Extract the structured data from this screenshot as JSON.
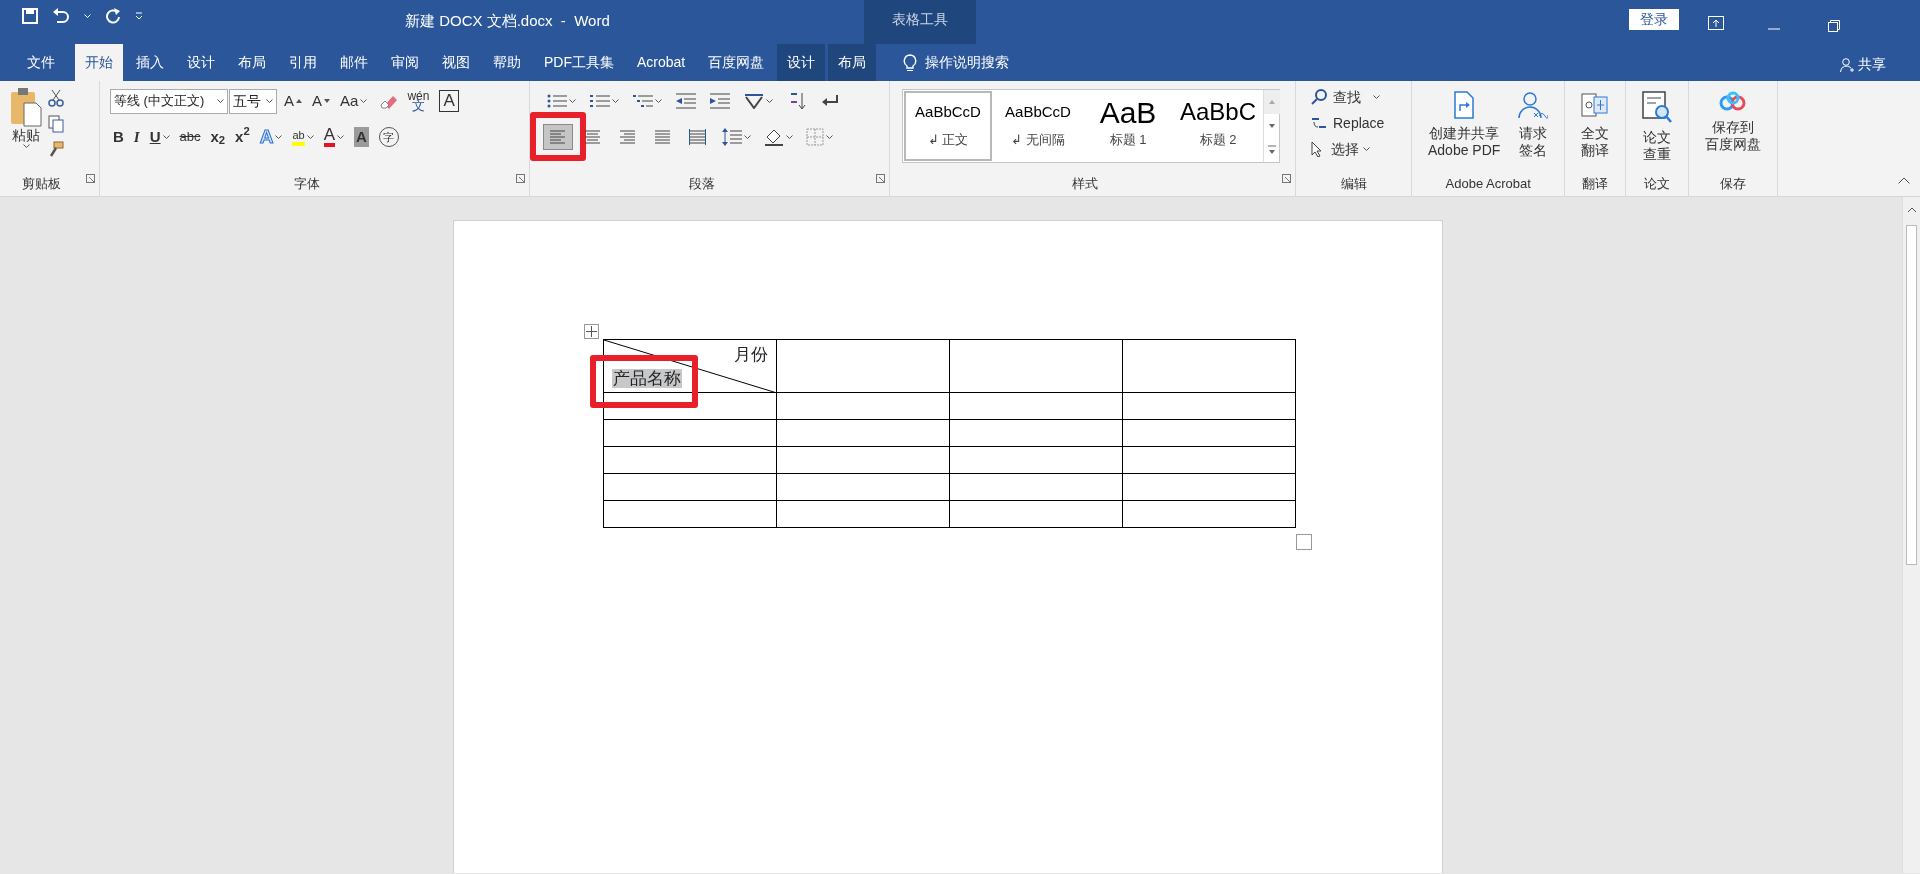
{
  "title_bar": {
    "title": "新建 DOCX 文档.docx  -  Word",
    "context_group": "表格工具",
    "login": "登录"
  },
  "tabs": [
    {
      "label": "文件",
      "kind": "file",
      "selected": false
    },
    {
      "label": "开始",
      "kind": "main",
      "selected": true
    },
    {
      "label": "插入",
      "kind": "main",
      "selected": false
    },
    {
      "label": "设计",
      "kind": "main",
      "selected": false
    },
    {
      "label": "布局",
      "kind": "main",
      "selected": false
    },
    {
      "label": "引用",
      "kind": "main",
      "selected": false
    },
    {
      "label": "邮件",
      "kind": "main",
      "selected": false
    },
    {
      "label": "审阅",
      "kind": "main",
      "selected": false
    },
    {
      "label": "视图",
      "kind": "main",
      "selected": false
    },
    {
      "label": "帮助",
      "kind": "main",
      "selected": false
    },
    {
      "label": "PDF工具集",
      "kind": "main",
      "selected": false
    },
    {
      "label": "Acrobat",
      "kind": "main",
      "selected": false
    },
    {
      "label": "百度网盘",
      "kind": "main",
      "selected": false
    },
    {
      "label": "设计",
      "kind": "context",
      "selected": false
    },
    {
      "label": "布局",
      "kind": "context",
      "selected": false
    }
  ],
  "tell_me": "操作说明搜索",
  "share": "共享",
  "clipboard": {
    "paste": "粘贴",
    "label": "剪贴板"
  },
  "font": {
    "label": "字体",
    "font_name": "等线 (中文正文)",
    "font_size": "五号",
    "row1": [
      {
        "kind": "grow",
        "text": "A"
      },
      {
        "kind": "shrink",
        "text": "A"
      },
      {
        "kind": "case",
        "text": "Aa"
      },
      {
        "kind": "clear"
      },
      {
        "kind": "phonetic",
        "ruby": "wén",
        "text": "文"
      },
      {
        "kind": "boxed",
        "text": "A"
      }
    ],
    "row2": [
      {
        "kind": "bold",
        "text": "B"
      },
      {
        "kind": "italic",
        "text": "I"
      },
      {
        "kind": "underline",
        "text": "U"
      },
      {
        "kind": "strike",
        "text": "abc"
      },
      {
        "kind": "sub",
        "text": "x$_{2}$"
      },
      {
        "kind": "sup",
        "text": "x$^{2}$"
      },
      {
        "kind": "effect",
        "text": "A"
      },
      {
        "kind": "highlight",
        "text": "ab"
      },
      {
        "kind": "color",
        "text": "A"
      },
      {
        "kind": "shade",
        "text": "A"
      },
      {
        "kind": "enclose",
        "text": "字"
      }
    ]
  },
  "paragraph": {
    "label": "段落",
    "row1": [
      {
        "kind": "bullets"
      },
      {
        "kind": "numbering"
      },
      {
        "kind": "multilevel"
      },
      {
        "kind": "outdent"
      },
      {
        "kind": "indent"
      },
      {
        "kind": "asian"
      },
      {
        "kind": "sort"
      },
      {
        "kind": "marks"
      }
    ],
    "row2": [
      {
        "kind": "align_left",
        "selected": true,
        "callout": true
      },
      {
        "kind": "align_center",
        "selected": false,
        "callout": false
      },
      {
        "kind": "align_right",
        "selected": false,
        "callout": false
      },
      {
        "kind": "align_justify",
        "selected": false,
        "callout": false
      },
      {
        "kind": "align_distribute",
        "selected": false,
        "callout": false
      },
      {
        "kind": "spacing"
      },
      {
        "kind": "shading"
      },
      {
        "kind": "borders"
      }
    ]
  },
  "styles": {
    "label": "样式",
    "items": [
      {
        "preview": "AaBbCcD",
        "name": "↲ 正文",
        "kind": "normal",
        "selected": true
      },
      {
        "preview": "AaBbCcD",
        "name": "↲ 无间隔",
        "kind": "normal",
        "selected": false
      },
      {
        "preview": "AaB",
        "name": "标题 1",
        "kind": "heading1",
        "selected": false
      },
      {
        "preview": "AaBbC",
        "name": "标题 2",
        "kind": "heading2",
        "selected": false
      }
    ]
  },
  "editing": {
    "label": "编辑",
    "find": "查找",
    "replace": "Replace",
    "select": "选择"
  },
  "big_groups": [
    {
      "label": "Adobe Acrobat",
      "buttons": [
        {
          "kind": "pdf",
          "lines": [
            "创建并共享",
            "Adobe PDF"
          ]
        },
        {
          "kind": "sign",
          "lines": [
            "请求",
            "签名"
          ]
        }
      ]
    },
    {
      "label": "翻译",
      "buttons": [
        {
          "kind": "translate",
          "lines": [
            "全文",
            "翻译"
          ]
        }
      ]
    },
    {
      "label": "论文",
      "buttons": [
        {
          "kind": "check",
          "lines": [
            "论文",
            "查重"
          ]
        }
      ]
    },
    {
      "label": "保存",
      "buttons": [
        {
          "kind": "cloud",
          "lines": [
            "保存到",
            "百度网盘"
          ]
        }
      ]
    }
  ],
  "table": {
    "corner": {
      "top": "月份",
      "bottom": "产品名称",
      "bottom_selected": true,
      "callout": true
    },
    "columns": [
      {
        "kind": "empty"
      },
      {
        "kind": "empty"
      },
      {
        "kind": "empty"
      }
    ],
    "body_rows": [
      {
        "kind": "empty"
      },
      {
        "kind": "empty"
      },
      {
        "kind": "empty"
      },
      {
        "kind": "empty"
      },
      {
        "kind": "empty"
      }
    ]
  }
}
